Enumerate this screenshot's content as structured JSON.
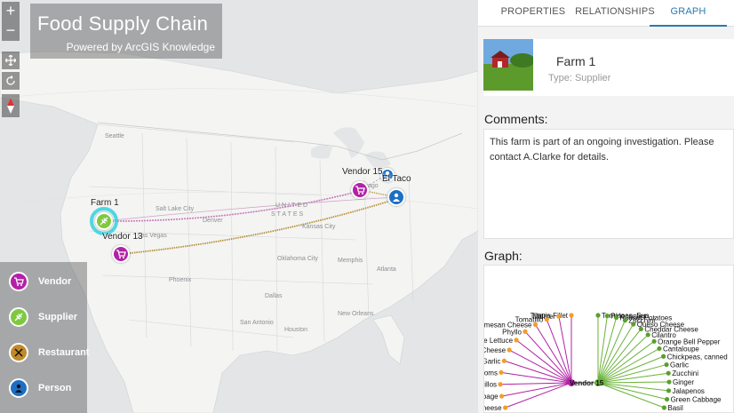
{
  "map": {
    "title": "Food Supply Chain",
    "subtitle": "Powered by ArcGIS Knowledge",
    "zoom_in": "+",
    "zoom_out": "−",
    "nodes": [
      {
        "label": "Farm 1",
        "kind": "supplier",
        "color": "#7ec93f"
      },
      {
        "label": "Vendor 13",
        "kind": "vendor",
        "color": "#b321a6"
      },
      {
        "label": "Vendor 15",
        "kind": "vendor",
        "color": "#b321a6"
      },
      {
        "label": "El Taco",
        "kind": "restaurant",
        "color": "#c08a2c"
      }
    ],
    "geo_labels": [
      "UNITED",
      "STATES",
      "Oklahoma City",
      "Denver",
      "Dallas",
      "Houston",
      "Chicago",
      "Phoenix",
      "Kansas City",
      "Memphis",
      "Atlanta",
      "Salt Lake City",
      "Las Vegas",
      "Seattle",
      "New Orleans",
      "San Antonio"
    ]
  },
  "legend": [
    {
      "label": "Vendor",
      "color": "#b321a6",
      "icon": "cart-icon"
    },
    {
      "label": "Supplier",
      "color": "#7ec93f",
      "icon": "wheat-icon"
    },
    {
      "label": "Restaurant",
      "color": "#c08a2c",
      "icon": "utensils-icon"
    },
    {
      "label": "Person",
      "color": "#1e6fc4",
      "icon": "person-icon"
    }
  ],
  "tabs": [
    "PROPERTIES",
    "RELATIONSHIPS",
    "GRAPH"
  ],
  "active_tab": "GRAPH",
  "entity": {
    "name": "Farm 1",
    "type": "Type: Supplier"
  },
  "comments_heading": "Comments:",
  "comments": "This farm is part of an ongoing investigation. Please contact A.Clarke for details.",
  "graph_heading": "Graph:",
  "graph": {
    "center_label": "Vendor 15",
    "left_items": [
      "Tilapia Fillet",
      "Millitter",
      "Tomatillo",
      "Parmesan Cheese",
      "Phyllo",
      "Romaine Lettuce",
      "Provolone Cheese",
      "Garlic",
      "Mushrooms",
      "Tomatillos",
      "Green Cabbage",
      "Swiss Cheese"
    ],
    "right_items": [
      "Tomatoes, Sun",
      "Pineapples",
      "Russet Potatoes",
      "Zucchini",
      "Queso Cheese",
      "Cheddar Cheese",
      "Cilantro",
      "Orange Bell Pepper",
      "Cantaloupe",
      "Chickpeas, canned",
      "Garlic",
      "Zucchini",
      "Ginger",
      "Jalapenos",
      "Green Cabbage",
      "Basil"
    ],
    "colors": {
      "vendor": "#b321a6",
      "supplier": "#6ab23a",
      "item_left": "#f29d2b",
      "item_right": "#5aa02c"
    }
  }
}
